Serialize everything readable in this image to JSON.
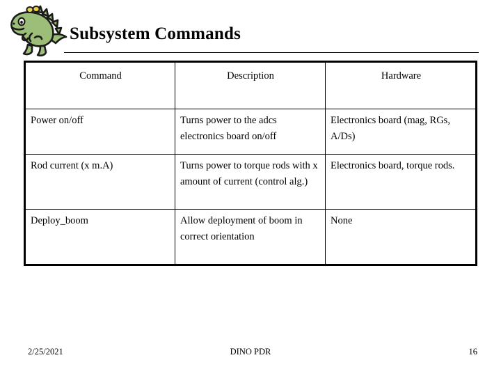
{
  "slide": {
    "title": "Subsystem Commands",
    "logo_icon": "dinosaur-logo-icon",
    "colors": {
      "dino_body": "#9CBE78",
      "dino_outline": "#1a1a1a",
      "dino_spots": "#E8D44A",
      "rule": "#000000",
      "table_border": "#000000",
      "text": "#000000",
      "background": "#FFFFFF"
    }
  },
  "table": {
    "columns": [
      "Command",
      "Description",
      "Hardware"
    ],
    "rows": [
      {
        "command": "Power on/off",
        "description": "Turns power to the adcs electronics board on/off",
        "hardware": "Electronics board (mag, RGs, A/Ds)"
      },
      {
        "command": "Rod current (x m.A)",
        "description": "Turns power to torque rods with x amount of current (control alg.)",
        "hardware": "Electronics board, torque rods."
      },
      {
        "command": "Deploy_boom",
        "description": "Allow deployment of boom in correct orientation",
        "hardware": "None"
      }
    ]
  },
  "footer": {
    "date": "2/25/2021",
    "center": "DINO PDR",
    "page": "16"
  }
}
